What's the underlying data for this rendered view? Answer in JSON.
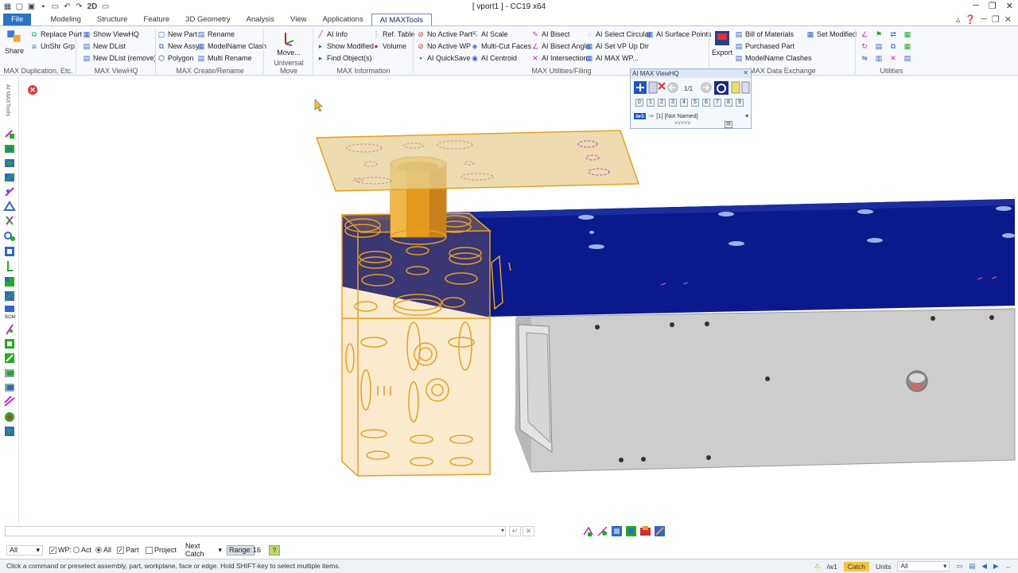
{
  "window": {
    "title": "[ vport1 ] - CC19 x64",
    "qat_mode": "2D"
  },
  "tabs": [
    "File",
    "Modeling",
    "Structure",
    "Feature",
    "3D Geometry",
    "Analysis",
    "View",
    "Applications",
    "AI MAXTools"
  ],
  "ribbon": {
    "dup": {
      "share": "Share",
      "replace": "Replace Part",
      "unshr": "UnShr  Grp",
      "label": "MAX Duplication, Etc."
    },
    "viewhq": {
      "show": "Show ViewHQ",
      "newd": "New DList",
      "newdr": "New DList (remove)",
      "label": "MAX ViewHQ"
    },
    "create": {
      "newpart": "New Part",
      "newassy": "New Assy",
      "polygon": "Polygon",
      "rename": "Rename",
      "mnclash": "ModelName Clash",
      "multirename": "Multi Rename",
      "label": "MAX Create/Rename"
    },
    "move": {
      "btn": "Move...",
      "label": "Universal Move"
    },
    "info": {
      "aiinfo": "AI Info",
      "showmod": "Show Modified",
      "findobj": "Find Object(s)",
      "reftable": "Ref. Table",
      "volume": "Volume",
      "label": "MAX Information"
    },
    "util": {
      "noactivepart": "No Active Part",
      "noactivewp": "No Active WP",
      "aiquicksave": "AI QuickSave",
      "aiscale": "AI Scale",
      "multicut": "Multi-Cut Faces",
      "aicentroid": "AI Centroid",
      "aibisect": "AI Bisect",
      "aibisectangle": "AI Bisect Angle",
      "aiintersection": "AI Intersection",
      "aiselcirc": "AI Select Circular",
      "aisetvp": "AI Set VP Up Dir",
      "aimaxwp": "AI MAX WP...",
      "aisurfpts": "AI Surface Points",
      "label": "MAX Utilities/Filing"
    },
    "exchange": {
      "export": "Export",
      "bom": "Bill of Materials",
      "purchased": "Purchased Part",
      "mnclashes": "ModelName Clashes",
      "setmod": "Set Modified",
      "label": "MAX Data Exchange"
    },
    "utilities": {
      "label": "Utilities"
    }
  },
  "leftbar": {
    "vertical_label": "AI MAXTools"
  },
  "viewhq": {
    "title": "AI MAX ViewHQ",
    "page": "1/1",
    "numbers": [
      "0",
      "1",
      "2",
      "3",
      "4",
      "5",
      "6",
      "7",
      "8",
      "9"
    ],
    "view_named": "[1] [Not Named]"
  },
  "options": {
    "filter": "All",
    "wp": "WP:",
    "act": "Act",
    "all": "All",
    "part": "Part",
    "project": "Project",
    "next_catch": "Next Catch",
    "range_label": "Range:",
    "range_value": "16"
  },
  "status": {
    "message": "Click a command or preselect assembly, part, workplane, face or edge. Hold SHIFT-key to select multiple items.",
    "wp": "/w1",
    "catch": "Catch",
    "units": "Units",
    "units_value": "All"
  },
  "colors": {
    "accent": "#2b73c2",
    "orange": "#e8a020",
    "blue": "#0a1a8c",
    "grey": "#cccccc"
  }
}
